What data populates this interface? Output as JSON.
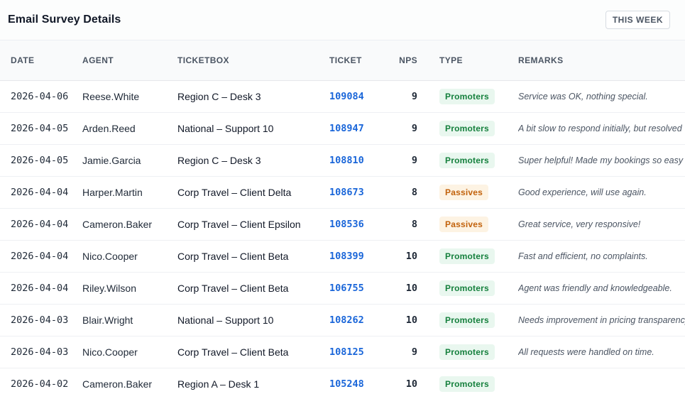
{
  "header": {
    "title": "Email Survey Details",
    "period_label": "THIS WEEK"
  },
  "table": {
    "columns": [
      "DATE",
      "AGENT",
      "TICKETBOX",
      "TICKET",
      "NPS",
      "TYPE",
      "REMARKS"
    ],
    "rows": [
      {
        "date": "2026-04-06",
        "agent": "Reese.White",
        "ticketbox": "Region C – Desk 3",
        "ticket": "109084",
        "nps": "9",
        "type": "Promoters",
        "remarks": "Service was OK, nothing special."
      },
      {
        "date": "2026-04-05",
        "agent": "Arden.Reed",
        "ticketbox": "National – Support 10",
        "ticket": "108947",
        "nps": "9",
        "type": "Promoters",
        "remarks": "A bit slow to respond initially, but resolved"
      },
      {
        "date": "2026-04-05",
        "agent": "Jamie.Garcia",
        "ticketbox": "Region C – Desk 3",
        "ticket": "108810",
        "nps": "9",
        "type": "Promoters",
        "remarks": "Super helpful! Made my bookings so easy"
      },
      {
        "date": "2026-04-04",
        "agent": "Harper.Martin",
        "ticketbox": "Corp Travel – Client Delta",
        "ticket": "108673",
        "nps": "8",
        "type": "Passives",
        "remarks": "Good experience, will use again."
      },
      {
        "date": "2026-04-04",
        "agent": "Cameron.Baker",
        "ticketbox": "Corp Travel – Client Epsilon",
        "ticket": "108536",
        "nps": "8",
        "type": "Passives",
        "remarks": "Great service, very responsive!"
      },
      {
        "date": "2026-04-04",
        "agent": "Nico.Cooper",
        "ticketbox": "Corp Travel – Client Beta",
        "ticket": "108399",
        "nps": "10",
        "type": "Promoters",
        "remarks": "Fast and efficient, no complaints."
      },
      {
        "date": "2026-04-04",
        "agent": "Riley.Wilson",
        "ticketbox": "Corp Travel – Client Beta",
        "ticket": "106755",
        "nps": "10",
        "type": "Promoters",
        "remarks": "Agent was friendly and knowledgeable."
      },
      {
        "date": "2026-04-03",
        "agent": "Blair.Wright",
        "ticketbox": "National – Support 10",
        "ticket": "108262",
        "nps": "10",
        "type": "Promoters",
        "remarks": "Needs improvement in pricing transparency"
      },
      {
        "date": "2026-04-03",
        "agent": "Nico.Cooper",
        "ticketbox": "Corp Travel – Client Beta",
        "ticket": "108125",
        "nps": "9",
        "type": "Promoters",
        "remarks": "All requests were handled on time."
      },
      {
        "date": "2026-04-02",
        "agent": "Cameron.Baker",
        "ticketbox": "Region A – Desk 1",
        "ticket": "105248",
        "nps": "10",
        "type": "Promoters",
        "remarks": ""
      }
    ]
  },
  "colors": {
    "ticket_link": "#1a66d9",
    "promoters_text": "#15803d",
    "promoters_bg": "#e9f7ef",
    "passives_text": "#c2620c",
    "passives_bg": "#fdf3e3"
  }
}
